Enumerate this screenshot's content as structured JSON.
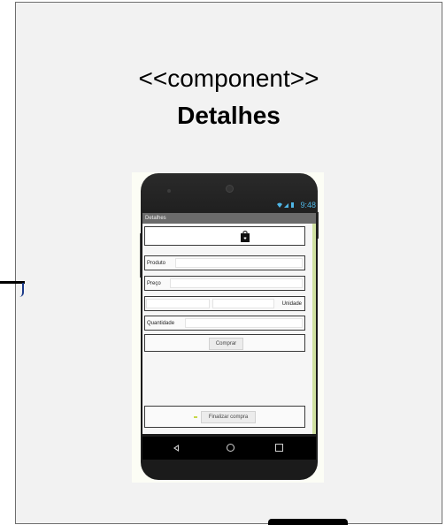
{
  "component": {
    "stereotype": "<<component>>",
    "name": "Detalhes"
  },
  "phone": {
    "status_time": "9:48",
    "status_icons": "wifi-icon signal-icon battery-icon",
    "app_title": "Detalhes",
    "header_icon": "shopping-bag-icon",
    "form": {
      "produto_label": "Produto",
      "preco_label": "Preço",
      "unidade_label": "Unidade",
      "quantidade_label": "Quantidade",
      "comprar_label": "Comprar",
      "finalizar_label": "Finalizar compra"
    },
    "nav": [
      "back-icon",
      "home-icon",
      "recent-apps-icon"
    ]
  },
  "colors": {
    "box_fill": "#f2f2f2",
    "box_border": "#6e6e6e",
    "statusbar_accent": "#4fb6e6",
    "rail": "#cfe0a0"
  }
}
